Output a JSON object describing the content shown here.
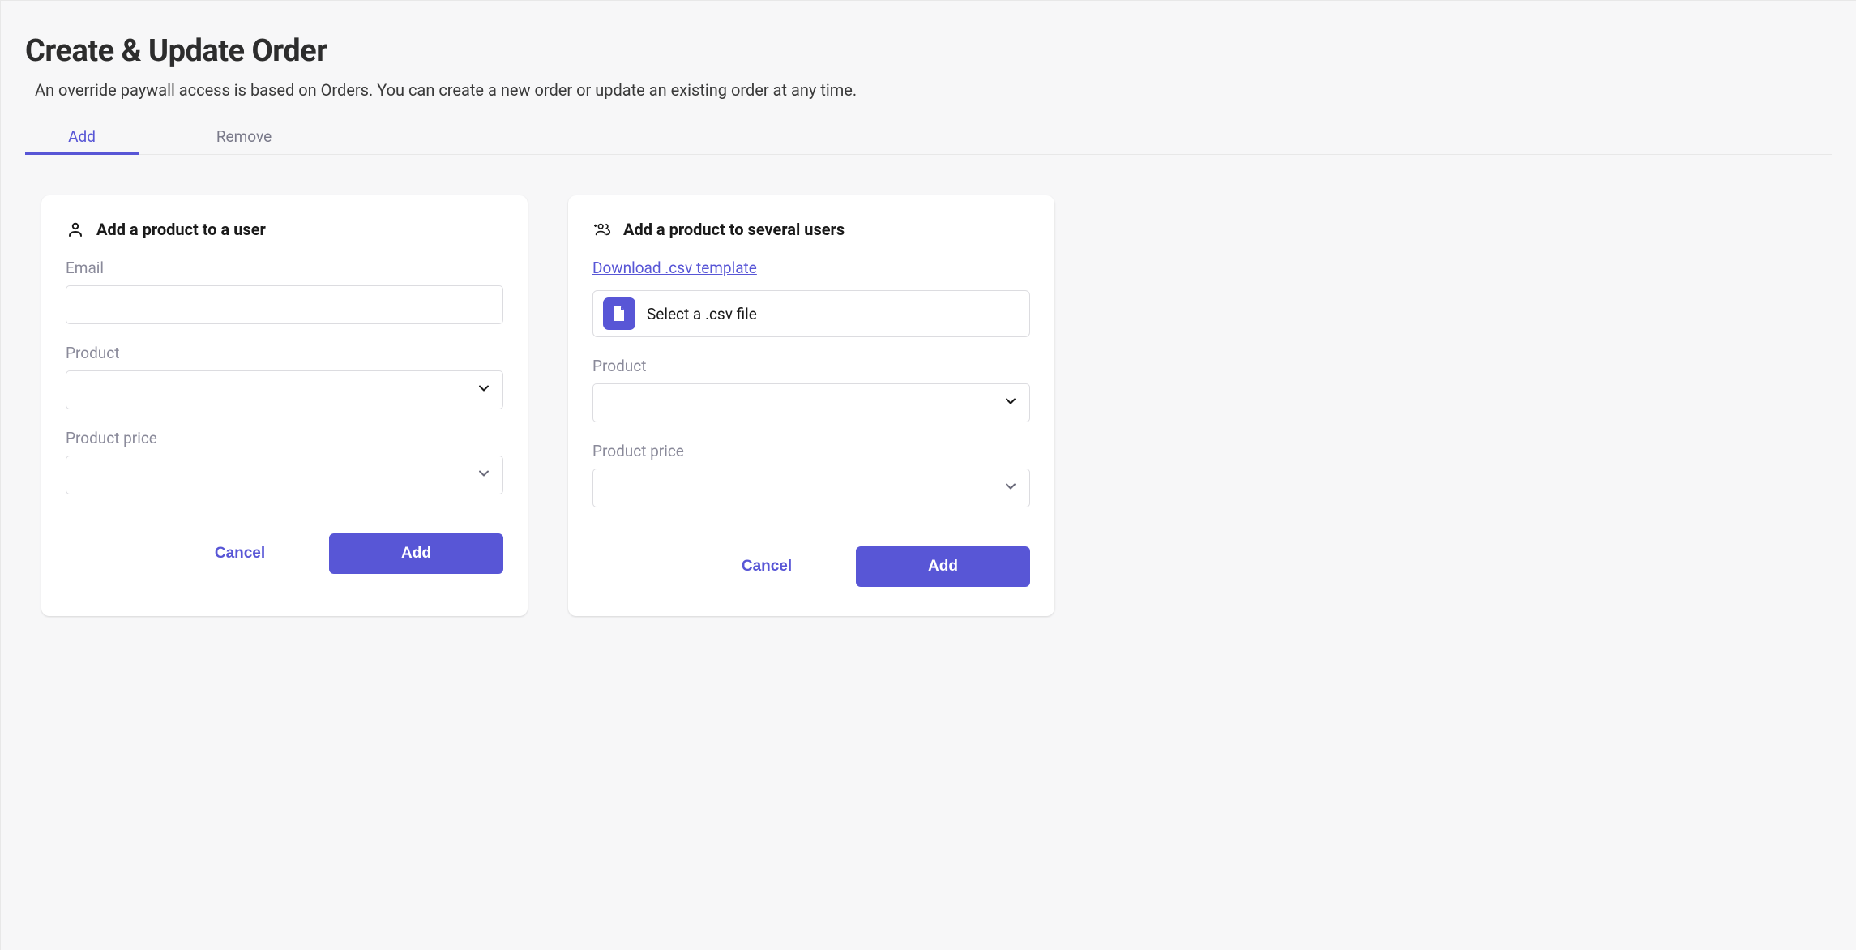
{
  "page": {
    "title": "Create & Update Order",
    "description": "An override paywall access is based on Orders. You can create a new order or update an existing order at any time."
  },
  "tabs": {
    "add": "Add",
    "remove": "Remove"
  },
  "single": {
    "title": "Add a product to a user",
    "email_label": "Email",
    "email_value": "",
    "product_label": "Product",
    "product_value": "",
    "price_label": "Product price",
    "price_value": "",
    "cancel": "Cancel",
    "submit": "Add"
  },
  "bulk": {
    "title": "Add a product to several users",
    "download_link": "Download .csv template",
    "file_picker_label": "Select a .csv file",
    "product_label": "Product",
    "product_value": "",
    "price_label": "Product price",
    "price_value": "",
    "cancel": "Cancel",
    "submit": "Add"
  }
}
